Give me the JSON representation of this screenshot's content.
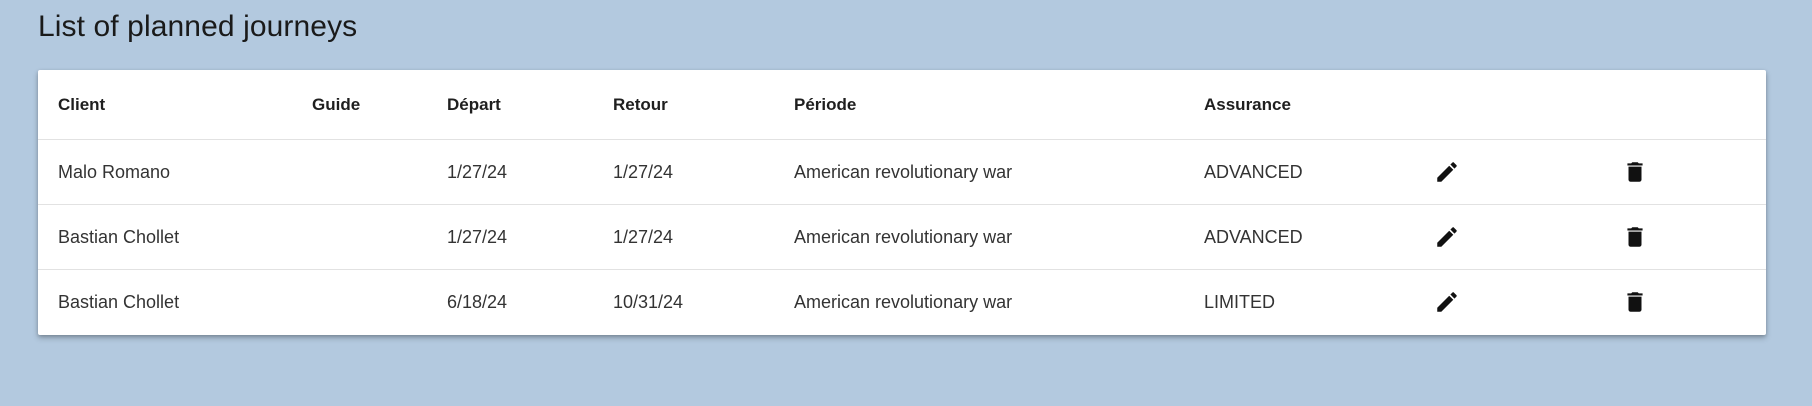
{
  "page": {
    "title": "List of planned journeys"
  },
  "table": {
    "headers": {
      "client": "Client",
      "guide": "Guide",
      "depart": "Départ",
      "retour": "Retour",
      "periode": "Période",
      "assurance": "Assurance"
    },
    "rows": [
      {
        "client": "Malo Romano",
        "guide": "",
        "depart": "1/27/24",
        "retour": "1/27/24",
        "periode": "American revolutionary war",
        "assurance": "ADVANCED"
      },
      {
        "client": "Bastian Chollet",
        "guide": "",
        "depart": "1/27/24",
        "retour": "1/27/24",
        "periode": "American revolutionary war",
        "assurance": "ADVANCED"
      },
      {
        "client": "Bastian Chollet",
        "guide": "",
        "depart": "6/18/24",
        "retour": "10/31/24",
        "periode": "American revolutionary war",
        "assurance": "LIMITED"
      }
    ]
  },
  "icons": {
    "edit": "pencil-icon",
    "delete": "trash-icon"
  },
  "colors": {
    "background": "#b3c9df",
    "card": "#ffffff",
    "text": "#222222"
  }
}
